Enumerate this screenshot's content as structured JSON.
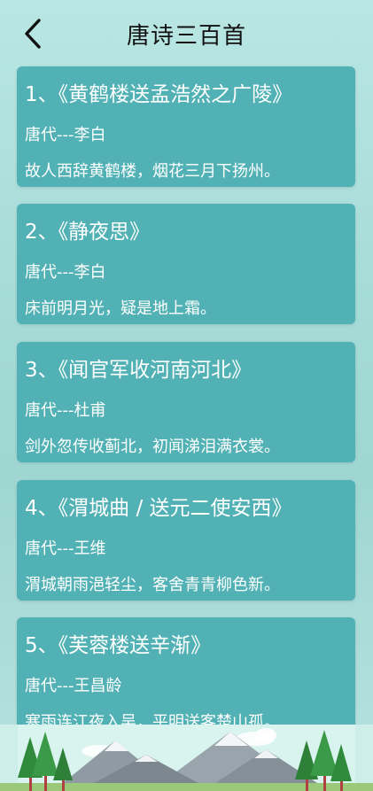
{
  "header": {
    "title": "唐诗三百首",
    "back_icon": "chevron-left-icon"
  },
  "poems": [
    {
      "title": "1、《黄鹤楼送孟浩然之广陵》",
      "author": "唐代---李白",
      "first_line": "故人西辞黄鹤楼，烟花三月下扬州。"
    },
    {
      "title": "2、《静夜思》",
      "author": "唐代---李白",
      "first_line": "床前明月光，疑是地上霜。"
    },
    {
      "title": "3、《闻官军收河南河北》",
      "author": "唐代---杜甫",
      "first_line": "剑外忽传收蓟北，初闻涕泪满衣裳。"
    },
    {
      "title": "4、《渭城曲 / 送元二使安西》",
      "author": "唐代---王维",
      "first_line": "渭城朝雨浥轻尘，客舍青青柳色新。"
    },
    {
      "title": "5、《芙蓉楼送辛渐》",
      "author": "唐代---王昌龄",
      "first_line": "寒雨连江夜入吴，平明送客楚山孤。"
    }
  ],
  "colors": {
    "card": "#51b1b4",
    "background": "#a7dcd8"
  }
}
